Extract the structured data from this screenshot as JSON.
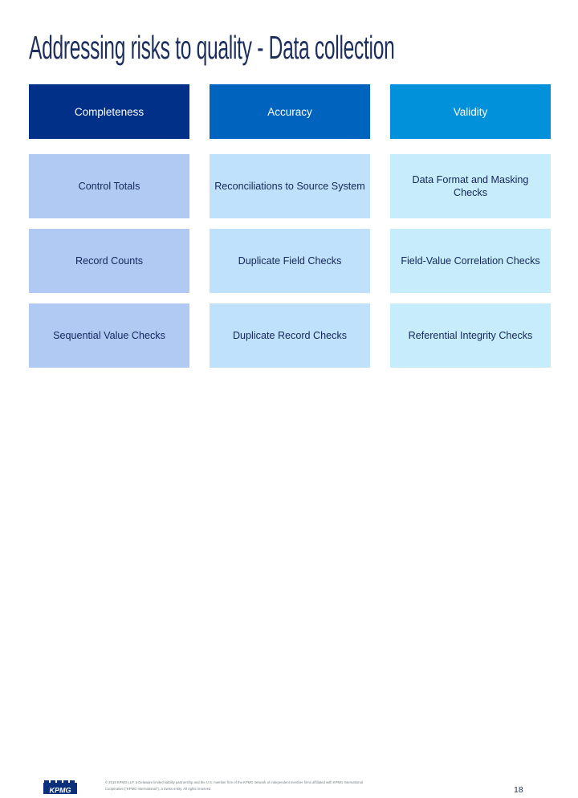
{
  "slide": {
    "title": "Addressing risks to quality - Data collection",
    "page_number": "18"
  },
  "table": {
    "columns": [
      {
        "header": "Completeness",
        "header_color": "#003087",
        "body_color": "#b0caf4",
        "cells": [
          "Control Totals",
          "Record Counts",
          "Sequential Value Checks"
        ]
      },
      {
        "header": "Accuracy",
        "header_color": "#0064bf",
        "body_color": "#bfe1fb",
        "cells": [
          "Reconciliations to Source System",
          "Duplicate Field Checks",
          "Duplicate Record Checks"
        ]
      },
      {
        "header": "Validity",
        "header_color": "#0091da",
        "body_color": "#c7ecfc",
        "cells": [
          "Data Format and Masking Checks",
          "Field-Value Correlation Checks",
          "Referential Integrity Checks"
        ]
      }
    ]
  },
  "footer": {
    "logo_name": "kpmg-logo",
    "logo_text": "KPMG",
    "copyright_line_1": "© 2018 KPMG LLP, a Delaware limited liability partnership and the U.S. member firm of the KPMG network of independent member firms affiliated with KPMG International",
    "copyright_line_2": "Cooperative (\"KPMG International\"), a Swiss entity. All rights reserved."
  },
  "colors": {
    "title": "#1d2f5e",
    "body_text": "#14265c",
    "header_text": "#ffffff",
    "footer_text": "#6f7a86",
    "page_number": "#1d2f5e",
    "background": "#ffffff"
  }
}
